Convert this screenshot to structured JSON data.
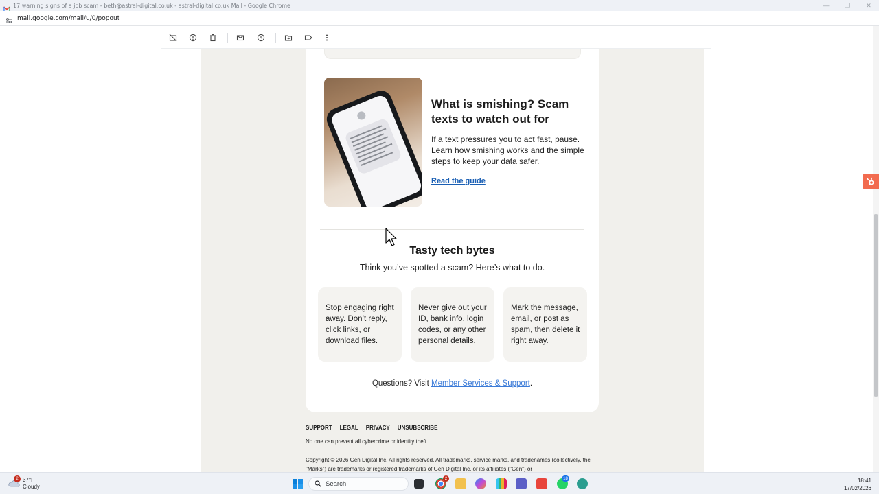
{
  "window": {
    "title": "17 warning signs of a job scam - beth@astral-digital.co.uk - astral-digital.co.uk Mail - Google Chrome",
    "minimize_glyph": "—",
    "restore_glyph": "❐",
    "close_glyph": "✕"
  },
  "address_bar": {
    "url": "mail.google.com/mail/u/0/popout"
  },
  "toolbar": {
    "icons": [
      "archive-icon",
      "report-spam-icon",
      "delete-icon",
      "mark-unread-icon",
      "snooze-icon",
      "move-to-icon",
      "label-icon",
      "more-icon"
    ]
  },
  "article": {
    "title": "What is smishing? Scam texts to watch out for",
    "body": "If a text pressures you to act fast, pause. Learn how smishing works and the simple steps to keep your data safer.",
    "link": "Read the guide",
    "image_alt": "smartphone showing a scam text message"
  },
  "section": {
    "title": "Tasty tech bytes",
    "subtitle": "Think you’ve spotted a scam? Here’s what to do.",
    "tips": [
      "Stop engaging right away. Don’t reply, click links, or download files.",
      "Never give out your ID, bank info, login codes, or any other personal details.",
      "Mark the message, email, or post as spam, then delete it right away."
    ],
    "questions_prefix": "Questions? Visit ",
    "questions_link": "Member Services & Support",
    "questions_suffix": "."
  },
  "footer": {
    "links": [
      "SUPPORT",
      "LEGAL",
      "PRIVACY",
      "UNSUBSCRIBE"
    ],
    "note": "No one can prevent all cybercrime or identity theft.",
    "copyright": "Copyright © 2026 Gen Digital Inc. All rights reserved. All trademarks, service marks, and tradenames (collectively, the \"Marks\") are trademarks or registered trademarks of Gen Digital Inc. or its affiliates (\"Gen\") or"
  },
  "taskbar": {
    "weather_temp": "37°F",
    "weather_condition": "Cloudy",
    "weather_badge": "2",
    "search_label": "Search",
    "chrome_badge": "2",
    "whatsapp_badge": "18",
    "time": "18:41",
    "date": "17/02/2026"
  },
  "colors": {
    "email_background": "#f1f0ec",
    "link_blue": "#1a5fb4",
    "hubspot_orange": "#f26b4f",
    "tip_card": "#f4f3f0"
  }
}
